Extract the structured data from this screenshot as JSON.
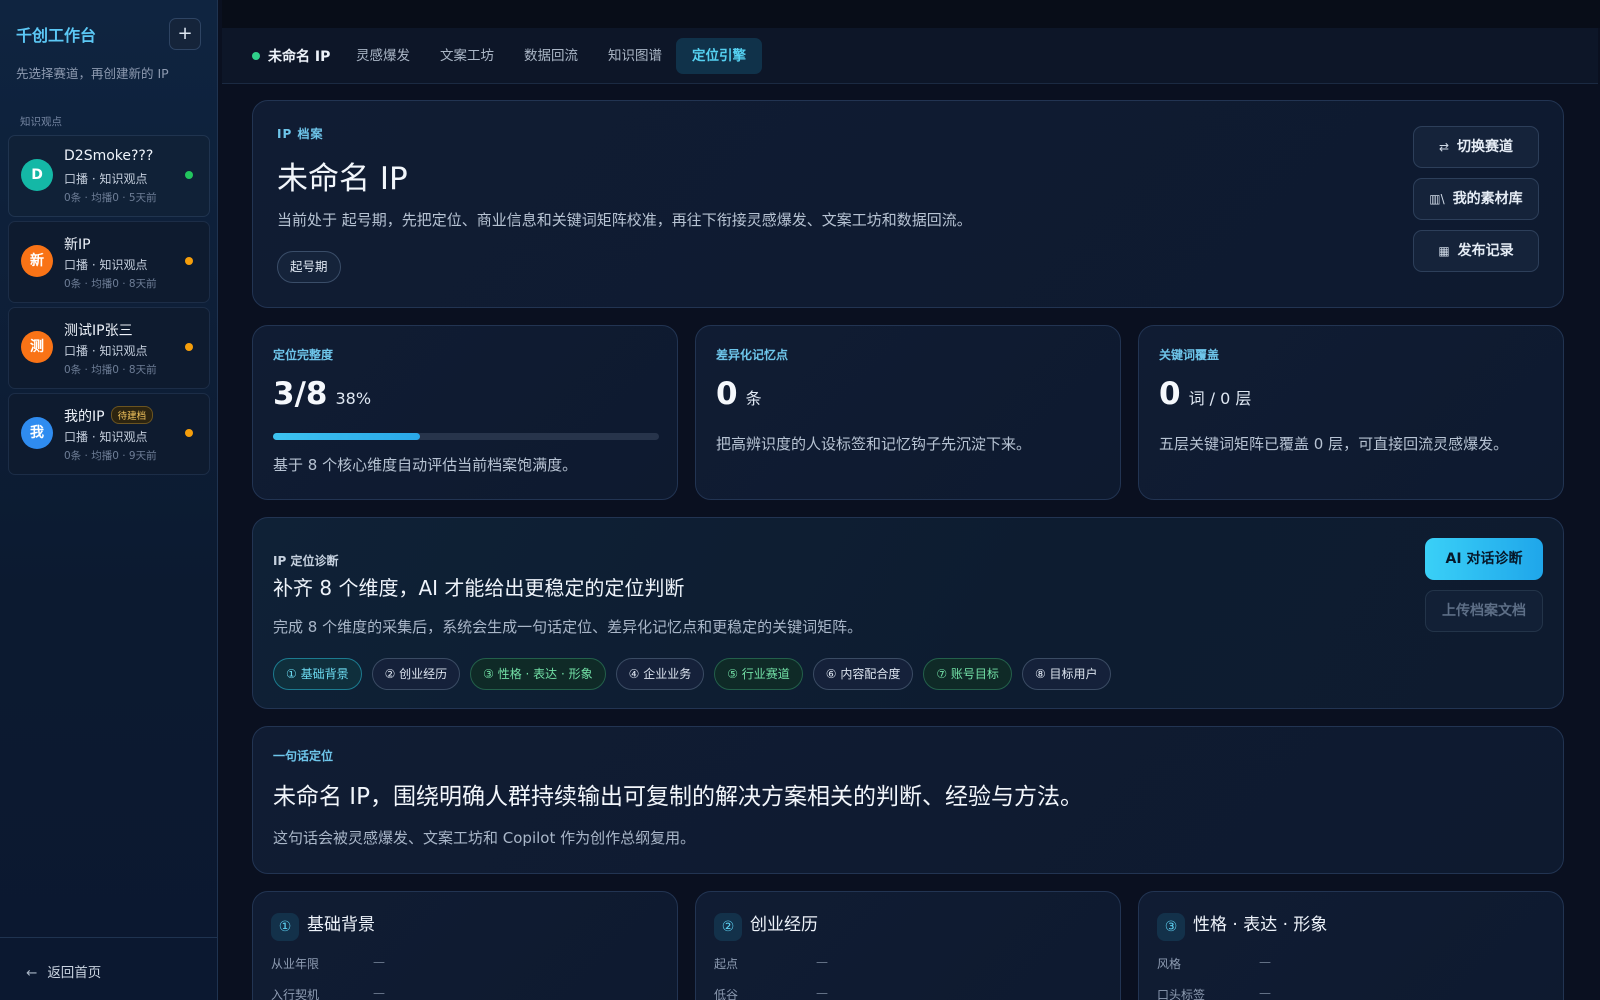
{
  "sidebar": {
    "title": "千创工作台",
    "add_label": "+",
    "subtitle": "先选择赛道，再创建新的 IP",
    "section_label": "知识观点",
    "ips": [
      {
        "avatar": "D",
        "name": "D2Smoke???",
        "meta": "口播 · 知识观点",
        "stats": "0条 · 均播0 · 5天前",
        "avatar_color": "#14b8a6",
        "dot_color": "#22c55e",
        "badge": ""
      },
      {
        "avatar": "新",
        "name": "新IP",
        "meta": "口播 · 知识观点",
        "stats": "0条 · 均播0 · 8天前",
        "avatar_color": "#f97316",
        "dot_color": "#f59e0b",
        "badge": ""
      },
      {
        "avatar": "测",
        "name": "测试IP张三",
        "meta": "口播 · 知识观点",
        "stats": "0条 · 均播0 · 8天前",
        "avatar_color": "#f97316",
        "dot_color": "#f59e0b",
        "badge": ""
      },
      {
        "avatar": "我",
        "name": "我的IP",
        "meta": "口播 · 知识观点",
        "stats": "0条 · 均播0 · 9天前",
        "avatar_color": "#2f8cf0",
        "dot_color": "#f59e0b",
        "badge": "待建档"
      }
    ],
    "back_icon": "←",
    "back_label": "返回首页"
  },
  "tabs": {
    "ip_name": "未命名 IP",
    "items": [
      "灵感爆发",
      "文案工坊",
      "数据回流",
      "知识图谱",
      "定位引擎"
    ],
    "active_index": 4
  },
  "profile": {
    "kicker": "IP 档案",
    "title": "未命名 IP",
    "desc": "当前处于 起号期，先把定位、商业信息和关键词矩阵校准，再往下衔接灵感爆发、文案工坊和数据回流。",
    "stage": "起号期",
    "buttons": [
      {
        "icon": "⇄",
        "label": "切换赛道"
      },
      {
        "icon": "▥\\",
        "label": "我的素材库"
      },
      {
        "icon": "▦",
        "label": "发布记录"
      }
    ]
  },
  "stats": {
    "completeness": {
      "kicker": "定位完整度",
      "value": "3/8",
      "percent_label": "38%",
      "progress": 0.38,
      "desc": "基于 8 个核心维度自动评估当前档案饱满度。"
    },
    "memory": {
      "kicker": "差异化记忆点",
      "value": "0",
      "unit": "条",
      "desc": "把高辨识度的人设标签和记忆钩子先沉淀下来。"
    },
    "keywords": {
      "kicker": "关键词覆盖",
      "value": "0",
      "unit": "词 / 0 层",
      "desc": "五层关键词矩阵已覆盖 0 层，可直接回流灵感爆发。"
    }
  },
  "diagnosis": {
    "kicker": "IP 定位诊断",
    "title": "补齐 8 个维度，AI 才能给出更稳定的定位判断",
    "desc": "完成 8 个维度的采集后，系统会生成一句话定位、差异化记忆点和更稳定的关键词矩阵。",
    "ai_button": "AI 对话诊断",
    "upload_button": "上传档案文档",
    "dimensions": [
      {
        "label": "① 基础背景",
        "state": "cyan"
      },
      {
        "label": "② 创业经历",
        "state": "plain"
      },
      {
        "label": "③ 性格 · 表达 · 形象",
        "state": "green"
      },
      {
        "label": "④ 企业业务",
        "state": "plain"
      },
      {
        "label": "⑤ 行业赛道",
        "state": "green"
      },
      {
        "label": "⑥ 内容配合度",
        "state": "plain"
      },
      {
        "label": "⑦ 账号目标",
        "state": "green"
      },
      {
        "label": "⑧ 目标用户",
        "state": "plain"
      }
    ]
  },
  "one_liner": {
    "kicker": "一句话定位",
    "text": "未命名 IP，围绕明确人群持续输出可复制的解决方案相关的判断、经验与方法。",
    "desc": "这句话会被灵感爆发、文案工坊和 Copilot 作为创作总纲复用。"
  },
  "dim_cards": [
    {
      "num": "①",
      "title": "基础背景",
      "fields": [
        {
          "label": "从业年限",
          "value": "—"
        },
        {
          "label": "入行契机",
          "value": "—"
        }
      ]
    },
    {
      "num": "②",
      "title": "创业经历",
      "fields": [
        {
          "label": "起点",
          "value": "—"
        },
        {
          "label": "低谷",
          "value": "—"
        }
      ]
    },
    {
      "num": "③",
      "title": "性格 · 表达 · 形象",
      "fields": [
        {
          "label": "风格",
          "value": "—"
        },
        {
          "label": "口头标签",
          "value": "—"
        }
      ]
    }
  ]
}
